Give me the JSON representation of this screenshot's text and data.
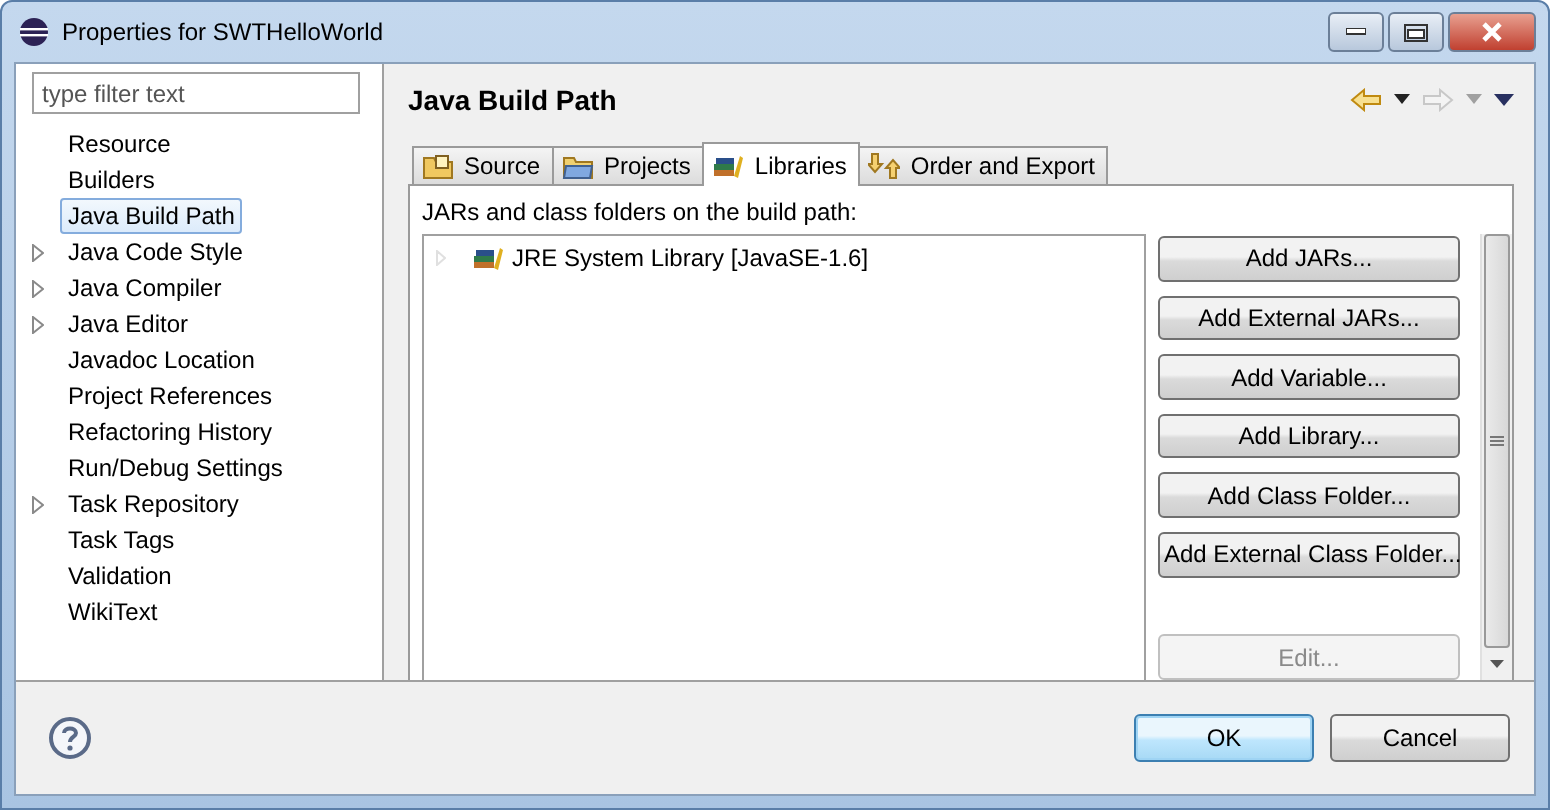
{
  "window": {
    "title": "Properties for SWTHelloWorld"
  },
  "filter": {
    "placeholder": "type filter text"
  },
  "sidebar": {
    "items": [
      {
        "label": "Resource",
        "expandable": false,
        "selected": false
      },
      {
        "label": "Builders",
        "expandable": false,
        "selected": false
      },
      {
        "label": "Java Build Path",
        "expandable": false,
        "selected": true
      },
      {
        "label": "Java Code Style",
        "expandable": true,
        "selected": false
      },
      {
        "label": "Java Compiler",
        "expandable": true,
        "selected": false
      },
      {
        "label": "Java Editor",
        "expandable": true,
        "selected": false
      },
      {
        "label": "Javadoc Location",
        "expandable": false,
        "selected": false
      },
      {
        "label": "Project References",
        "expandable": false,
        "selected": false
      },
      {
        "label": "Refactoring History",
        "expandable": false,
        "selected": false
      },
      {
        "label": "Run/Debug Settings",
        "expandable": false,
        "selected": false
      },
      {
        "label": "Task Repository",
        "expandable": true,
        "selected": false
      },
      {
        "label": "Task Tags",
        "expandable": false,
        "selected": false
      },
      {
        "label": "Validation",
        "expandable": false,
        "selected": false
      },
      {
        "label": "WikiText",
        "expandable": false,
        "selected": false
      }
    ]
  },
  "page": {
    "title": "Java Build Path"
  },
  "tabs": [
    {
      "label": "Source",
      "kind": "source",
      "selected": false
    },
    {
      "label": "Projects",
      "kind": "projects",
      "selected": false
    },
    {
      "label": "Libraries",
      "kind": "libraries",
      "selected": true
    },
    {
      "label": "Order and Export",
      "kind": "order",
      "selected": false
    }
  ],
  "libraries": {
    "caption": "JARs and class folders on the build path:",
    "entries": [
      {
        "label": "JRE System Library [JavaSE-1.6]",
        "expandable": true
      }
    ],
    "buttons": [
      {
        "label": "Add JARs...",
        "disabled": false
      },
      {
        "label": "Add External JARs...",
        "disabled": false
      },
      {
        "label": "Add Variable...",
        "disabled": false
      },
      {
        "label": "Add Library...",
        "disabled": false
      },
      {
        "label": "Add Class Folder...",
        "disabled": false
      },
      {
        "label": "Add External Class Folder...",
        "disabled": false
      },
      {
        "label": "Edit...",
        "disabled": true
      }
    ]
  },
  "footer": {
    "buttons": [
      {
        "label": "OK",
        "default": true
      },
      {
        "label": "Cancel",
        "default": false
      }
    ]
  }
}
